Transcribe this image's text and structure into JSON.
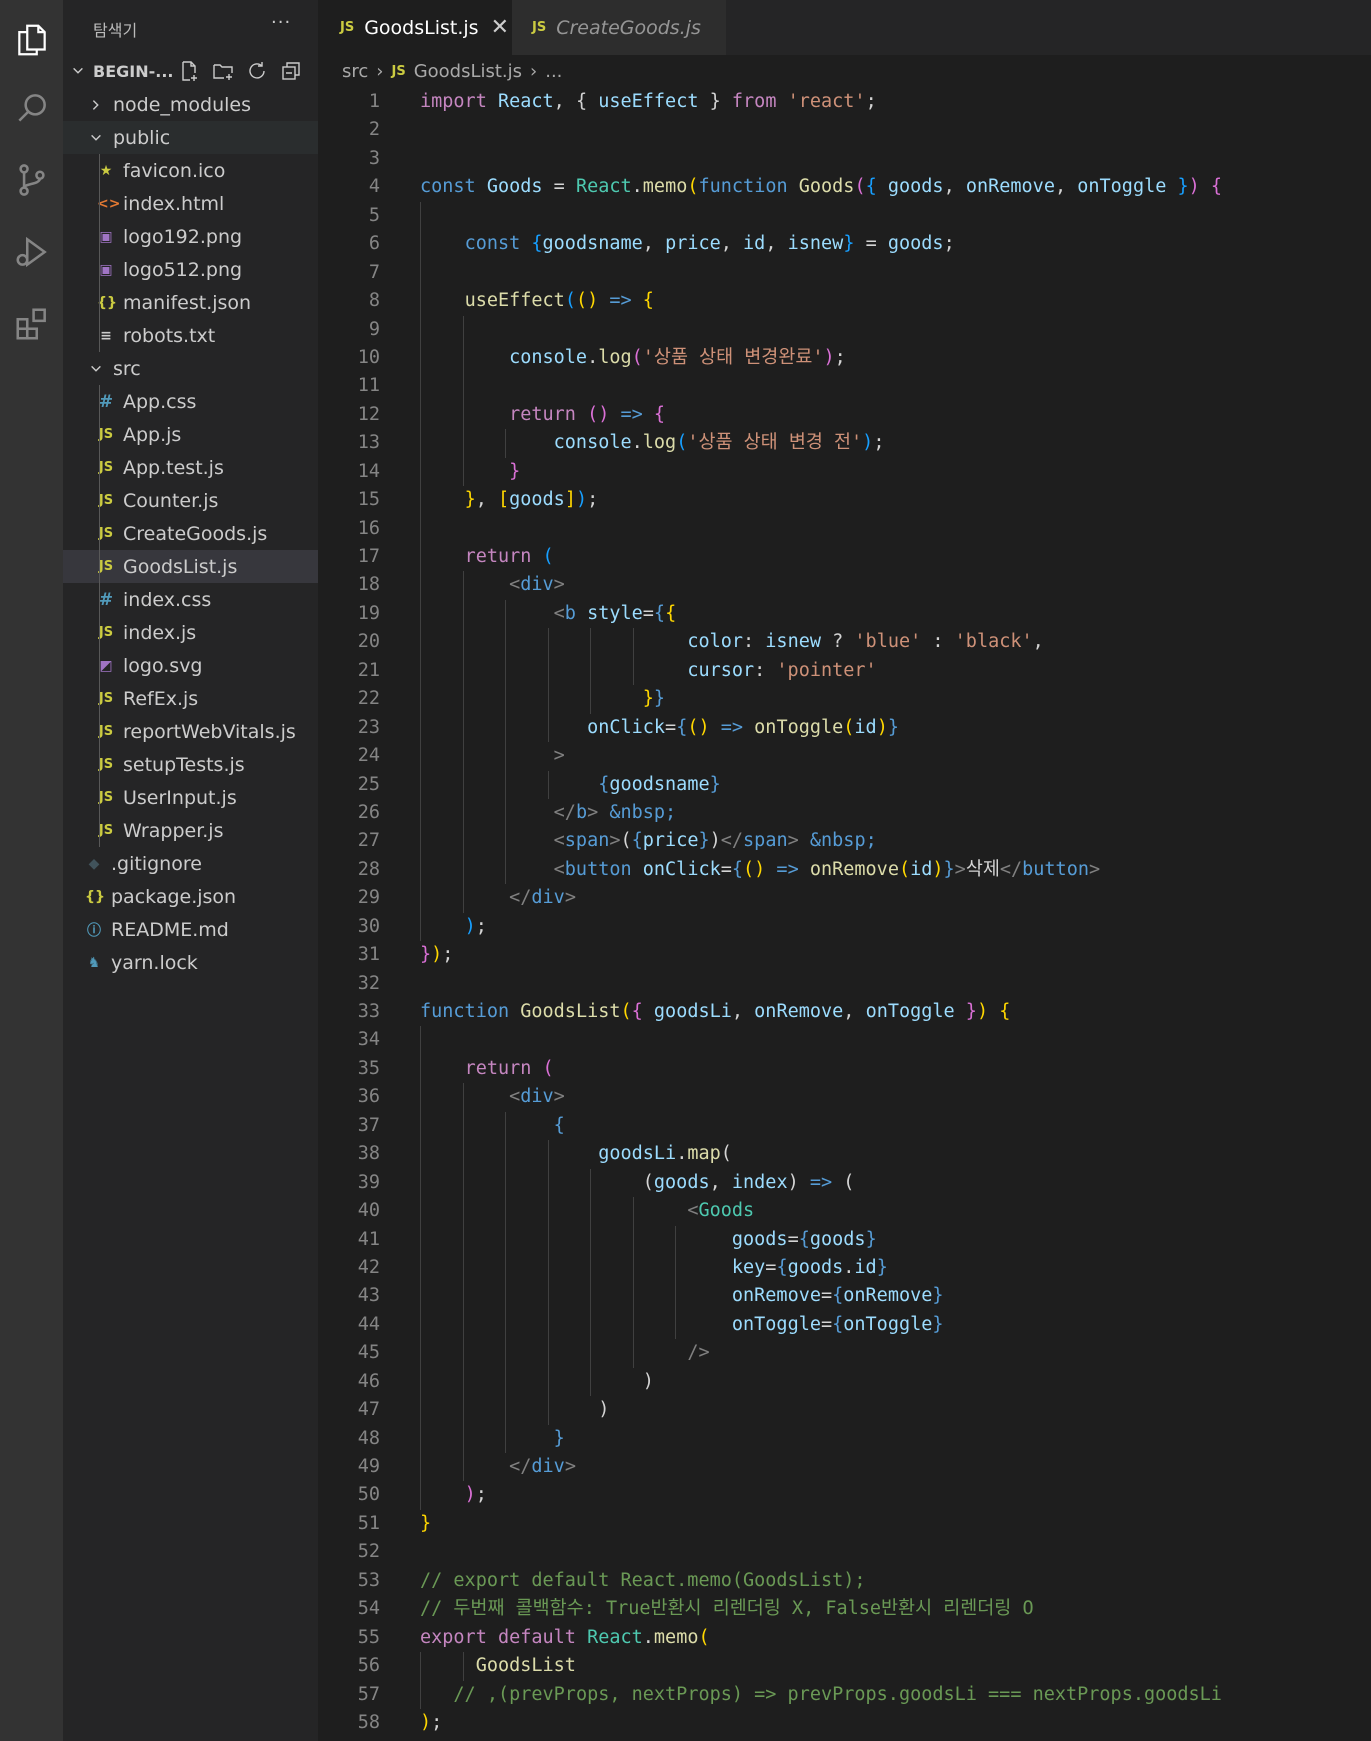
{
  "explorer": {
    "title": "탐색기",
    "more": "···",
    "project": "BEGIN-...",
    "items": [
      {
        "label": "node_modules",
        "kind": "folder-closed",
        "depth": 1
      },
      {
        "label": "public",
        "kind": "folder-open",
        "depth": 1
      },
      {
        "label": "favicon.ico",
        "kind": "ico",
        "depth": 2
      },
      {
        "label": "index.html",
        "kind": "html",
        "depth": 2
      },
      {
        "label": "logo192.png",
        "kind": "img",
        "depth": 2
      },
      {
        "label": "logo512.png",
        "kind": "img",
        "depth": 2
      },
      {
        "label": "manifest.json",
        "kind": "json",
        "depth": 2
      },
      {
        "label": "robots.txt",
        "kind": "txt",
        "depth": 2
      },
      {
        "label": "src",
        "kind": "folder-open",
        "depth": 1
      },
      {
        "label": "App.css",
        "kind": "css",
        "depth": 2
      },
      {
        "label": "App.js",
        "kind": "js",
        "depth": 2
      },
      {
        "label": "App.test.js",
        "kind": "js",
        "depth": 2
      },
      {
        "label": "Counter.js",
        "kind": "js",
        "depth": 2
      },
      {
        "label": "CreateGoods.js",
        "kind": "js",
        "depth": 2
      },
      {
        "label": "GoodsList.js",
        "kind": "js",
        "depth": 2,
        "selected": true
      },
      {
        "label": "index.css",
        "kind": "css",
        "depth": 2
      },
      {
        "label": "index.js",
        "kind": "js",
        "depth": 2
      },
      {
        "label": "logo.svg",
        "kind": "svg",
        "depth": 2
      },
      {
        "label": "RefEx.js",
        "kind": "js",
        "depth": 2
      },
      {
        "label": "reportWebVitals.js",
        "kind": "js",
        "depth": 2
      },
      {
        "label": "setupTests.js",
        "kind": "js",
        "depth": 2
      },
      {
        "label": "UserInput.js",
        "kind": "js",
        "depth": 2
      },
      {
        "label": "Wrapper.js",
        "kind": "js",
        "depth": 2
      },
      {
        "label": ".gitignore",
        "kind": "git",
        "depth": 1
      },
      {
        "label": "package.json",
        "kind": "json",
        "depth": 1
      },
      {
        "label": "README.md",
        "kind": "info",
        "depth": 1
      },
      {
        "label": "yarn.lock",
        "kind": "yarn",
        "depth": 1
      }
    ]
  },
  "tabs": [
    {
      "icon": "JS",
      "label": "GoodsList.js",
      "active": true,
      "close": "✕"
    },
    {
      "icon": "JS",
      "label": "CreateGoods.js",
      "active": false
    }
  ],
  "breadcrumb": {
    "folder": "src",
    "file_icon": "JS",
    "file": "GoodsList.js",
    "rest": "..."
  },
  "colors": {
    "keyword": "#c586c0",
    "string": "#ce9178",
    "variable": "#9cdcfe",
    "function": "#dcdcaa",
    "component": "#4ec9b0",
    "storage": "#569cd6",
    "comment": "#6a9955"
  },
  "code_lines": [
    [
      [
        "k",
        "import "
      ],
      [
        "v",
        "React"
      ],
      [
        "p",
        ", { "
      ],
      [
        "v",
        "useEffect"
      ],
      [
        "p",
        " } "
      ],
      [
        "k",
        "from "
      ],
      [
        "s",
        "'react'"
      ],
      [
        "p",
        ";"
      ]
    ],
    [],
    [],
    [
      [
        "b",
        "const "
      ],
      [
        "v",
        "Goods"
      ],
      [
        "p",
        " = "
      ],
      [
        "t",
        "React"
      ],
      [
        "p",
        "."
      ],
      [
        "f",
        "memo"
      ],
      [
        "y",
        "("
      ],
      [
        "b",
        "function "
      ],
      [
        "f",
        "Goods"
      ],
      [
        "pk",
        "("
      ],
      [
        "bl",
        "{ "
      ],
      [
        "v",
        "goods"
      ],
      [
        "p",
        ", "
      ],
      [
        "v",
        "onRemove"
      ],
      [
        "p",
        ", "
      ],
      [
        "v",
        "onToggle"
      ],
      [
        "bl",
        " }"
      ],
      [
        "pk",
        ")"
      ],
      [
        "p",
        " "
      ],
      [
        "pk",
        "{"
      ]
    ],
    [],
    [
      [
        "p",
        "    "
      ],
      [
        "b",
        "const "
      ],
      [
        "bl",
        "{"
      ],
      [
        "v",
        "goodsname"
      ],
      [
        "p",
        ", "
      ],
      [
        "v",
        "price"
      ],
      [
        "p",
        ", "
      ],
      [
        "v",
        "id"
      ],
      [
        "p",
        ", "
      ],
      [
        "v",
        "isnew"
      ],
      [
        "bl",
        "}"
      ],
      [
        "p",
        " = "
      ],
      [
        "v",
        "goods"
      ],
      [
        "p",
        ";"
      ]
    ],
    [],
    [
      [
        "p",
        "    "
      ],
      [
        "f",
        "useEffect"
      ],
      [
        "bl",
        "("
      ],
      [
        "y",
        "()"
      ],
      [
        "b",
        " => "
      ],
      [
        "y",
        "{"
      ]
    ],
    [],
    [
      [
        "p",
        "        "
      ],
      [
        "v",
        "console"
      ],
      [
        "p",
        "."
      ],
      [
        "f",
        "log"
      ],
      [
        "pk",
        "("
      ],
      [
        "s",
        "'상품 상태 변경완료'"
      ],
      [
        "pk",
        ")"
      ],
      [
        "p",
        ";"
      ]
    ],
    [],
    [
      [
        "p",
        "        "
      ],
      [
        "k",
        "return "
      ],
      [
        "pk",
        "()"
      ],
      [
        "b",
        " => "
      ],
      [
        "pk",
        "{"
      ]
    ],
    [
      [
        "p",
        "            "
      ],
      [
        "v",
        "console"
      ],
      [
        "p",
        "."
      ],
      [
        "f",
        "log"
      ],
      [
        "bl",
        "("
      ],
      [
        "s",
        "'상품 상태 변경 전'"
      ],
      [
        "bl",
        ")"
      ],
      [
        "p",
        ";"
      ]
    ],
    [
      [
        "p",
        "        "
      ],
      [
        "pk",
        "}"
      ]
    ],
    [
      [
        "p",
        "    "
      ],
      [
        "y",
        "}"
      ],
      [
        "p",
        ", "
      ],
      [
        "y",
        "["
      ],
      [
        "v",
        "goods"
      ],
      [
        "y",
        "]"
      ],
      [
        "bl",
        ")"
      ],
      [
        "p",
        ";"
      ]
    ],
    [],
    [
      [
        "p",
        "    "
      ],
      [
        "k",
        "return "
      ],
      [
        "bl",
        "("
      ]
    ],
    [
      [
        "p",
        "        "
      ],
      [
        "g",
        "<"
      ],
      [
        "b",
        "div"
      ],
      [
        "g",
        ">"
      ]
    ],
    [
      [
        "p",
        "            "
      ],
      [
        "g",
        "<"
      ],
      [
        "b",
        "b "
      ],
      [
        "v",
        "style"
      ],
      [
        "p",
        "="
      ],
      [
        "b",
        "{"
      ],
      [
        "y",
        "{"
      ]
    ],
    [
      [
        "p",
        "                        "
      ],
      [
        "v",
        "color"
      ],
      [
        "p",
        ": "
      ],
      [
        "v",
        "isnew"
      ],
      [
        "p",
        " ? "
      ],
      [
        "s",
        "'blue'"
      ],
      [
        "p",
        " : "
      ],
      [
        "s",
        "'black'"
      ],
      [
        "p",
        ","
      ]
    ],
    [
      [
        "p",
        "                        "
      ],
      [
        "v",
        "cursor"
      ],
      [
        "p",
        ": "
      ],
      [
        "s",
        "'pointer'"
      ]
    ],
    [
      [
        "p",
        "                    "
      ],
      [
        "y",
        "}"
      ],
      [
        "b",
        "}"
      ]
    ],
    [
      [
        "p",
        "               "
      ],
      [
        "v",
        "onClick"
      ],
      [
        "p",
        "="
      ],
      [
        "b",
        "{"
      ],
      [
        "y",
        "()"
      ],
      [
        "b",
        " => "
      ],
      [
        "f",
        "onToggle"
      ],
      [
        "y",
        "("
      ],
      [
        "v",
        "id"
      ],
      [
        "y",
        ")"
      ],
      [
        "b",
        "}"
      ]
    ],
    [
      [
        "p",
        "            "
      ],
      [
        "g",
        ">"
      ]
    ],
    [
      [
        "p",
        "                "
      ],
      [
        "b",
        "{"
      ],
      [
        "v",
        "goodsname"
      ],
      [
        "b",
        "}"
      ]
    ],
    [
      [
        "p",
        "            "
      ],
      [
        "g",
        "</"
      ],
      [
        "b",
        "b"
      ],
      [
        "g",
        ">"
      ],
      [
        "b",
        " &nbsp;"
      ]
    ],
    [
      [
        "p",
        "            "
      ],
      [
        "g",
        "<"
      ],
      [
        "b",
        "span"
      ],
      [
        "g",
        ">"
      ],
      [
        "p",
        "("
      ],
      [
        "b",
        "{"
      ],
      [
        "v",
        "price"
      ],
      [
        "b",
        "}"
      ],
      [
        "p",
        ")"
      ],
      [
        "g",
        "</"
      ],
      [
        "b",
        "span"
      ],
      [
        "g",
        ">"
      ],
      [
        "b",
        " &nbsp;"
      ]
    ],
    [
      [
        "p",
        "            "
      ],
      [
        "g",
        "<"
      ],
      [
        "b",
        "button "
      ],
      [
        "v",
        "onClick"
      ],
      [
        "p",
        "="
      ],
      [
        "b",
        "{"
      ],
      [
        "y",
        "()"
      ],
      [
        "b",
        " => "
      ],
      [
        "f",
        "onRemove"
      ],
      [
        "y",
        "("
      ],
      [
        "v",
        "id"
      ],
      [
        "y",
        ")"
      ],
      [
        "b",
        "}"
      ],
      [
        "g",
        ">"
      ],
      [
        "p",
        "삭제"
      ],
      [
        "g",
        "</"
      ],
      [
        "b",
        "button"
      ],
      [
        "g",
        ">"
      ]
    ],
    [
      [
        "p",
        "        "
      ],
      [
        "g",
        "</"
      ],
      [
        "b",
        "div"
      ],
      [
        "g",
        ">"
      ]
    ],
    [
      [
        "p",
        "    "
      ],
      [
        "bl",
        ")"
      ],
      [
        "p",
        ";"
      ]
    ],
    [
      [
        "pk",
        "}"
      ],
      [
        "y",
        ")"
      ],
      [
        "p",
        ";"
      ]
    ],
    [],
    [
      [
        "b",
        "function "
      ],
      [
        "f",
        "GoodsList"
      ],
      [
        "y",
        "("
      ],
      [
        "pk",
        "{ "
      ],
      [
        "v",
        "goodsLi"
      ],
      [
        "p",
        ", "
      ],
      [
        "v",
        "onRemove"
      ],
      [
        "p",
        ", "
      ],
      [
        "v",
        "onToggle"
      ],
      [
        "pk",
        " }"
      ],
      [
        "y",
        ")"
      ],
      [
        "p",
        " "
      ],
      [
        "y",
        "{"
      ]
    ],
    [],
    [
      [
        "p",
        "    "
      ],
      [
        "k",
        "return "
      ],
      [
        "pk",
        "("
      ]
    ],
    [
      [
        "p",
        "        "
      ],
      [
        "g",
        "<"
      ],
      [
        "b",
        "div"
      ],
      [
        "g",
        ">"
      ]
    ],
    [
      [
        "p",
        "            "
      ],
      [
        "b",
        "{"
      ]
    ],
    [
      [
        "p",
        "                "
      ],
      [
        "v",
        "goodsLi"
      ],
      [
        "p",
        "."
      ],
      [
        "f",
        "map"
      ],
      [
        "p",
        "("
      ]
    ],
    [
      [
        "p",
        "                    "
      ],
      [
        "p",
        "("
      ],
      [
        "v",
        "goods"
      ],
      [
        "p",
        ", "
      ],
      [
        "v",
        "index"
      ],
      [
        "p",
        ")"
      ],
      [
        "b",
        " => "
      ],
      [
        "p",
        "("
      ]
    ],
    [
      [
        "p",
        "                        "
      ],
      [
        "g",
        "<"
      ],
      [
        "t",
        "Goods"
      ]
    ],
    [
      [
        "p",
        "                            "
      ],
      [
        "v",
        "goods"
      ],
      [
        "p",
        "="
      ],
      [
        "b",
        "{"
      ],
      [
        "v",
        "goods"
      ],
      [
        "b",
        "}"
      ]
    ],
    [
      [
        "p",
        "                            "
      ],
      [
        "v",
        "key"
      ],
      [
        "p",
        "="
      ],
      [
        "b",
        "{"
      ],
      [
        "v",
        "goods"
      ],
      [
        "p",
        "."
      ],
      [
        "v",
        "id"
      ],
      [
        "b",
        "}"
      ]
    ],
    [
      [
        "p",
        "                            "
      ],
      [
        "v",
        "onRemove"
      ],
      [
        "p",
        "="
      ],
      [
        "b",
        "{"
      ],
      [
        "v",
        "onRemove"
      ],
      [
        "b",
        "}"
      ]
    ],
    [
      [
        "p",
        "                            "
      ],
      [
        "v",
        "onToggle"
      ],
      [
        "p",
        "="
      ],
      [
        "b",
        "{"
      ],
      [
        "v",
        "onToggle"
      ],
      [
        "b",
        "}"
      ]
    ],
    [
      [
        "p",
        "                        "
      ],
      [
        "g",
        "/>"
      ]
    ],
    [
      [
        "p",
        "                    "
      ],
      [
        "p",
        ")"
      ]
    ],
    [
      [
        "p",
        "                "
      ],
      [
        "p",
        ")"
      ]
    ],
    [
      [
        "p",
        "            "
      ],
      [
        "b",
        "}"
      ]
    ],
    [
      [
        "p",
        "        "
      ],
      [
        "g",
        "</"
      ],
      [
        "b",
        "div"
      ],
      [
        "g",
        ">"
      ]
    ],
    [
      [
        "p",
        "    "
      ],
      [
        "pk",
        ")"
      ],
      [
        "p",
        ";"
      ]
    ],
    [
      [
        "y",
        "}"
      ]
    ],
    [],
    [
      [
        "c",
        "// export default React.memo(GoodsList);"
      ]
    ],
    [
      [
        "c",
        "// 두번째 콜백함수: True반환시 리렌더링 X, False반환시 리렌더링 O"
      ]
    ],
    [
      [
        "k",
        "export "
      ],
      [
        "k",
        "default "
      ],
      [
        "t",
        "React"
      ],
      [
        "p",
        "."
      ],
      [
        "f",
        "memo"
      ],
      [
        "y",
        "("
      ]
    ],
    [
      [
        "p",
        "     "
      ],
      [
        "f",
        "GoodsList"
      ]
    ],
    [
      [
        "p",
        "   "
      ],
      [
        "c",
        "// ,(prevProps, nextProps) => prevProps.goodsLi === nextProps.goodsLi"
      ]
    ],
    [
      [
        "y",
        ")"
      ],
      [
        "p",
        ";"
      ]
    ]
  ]
}
